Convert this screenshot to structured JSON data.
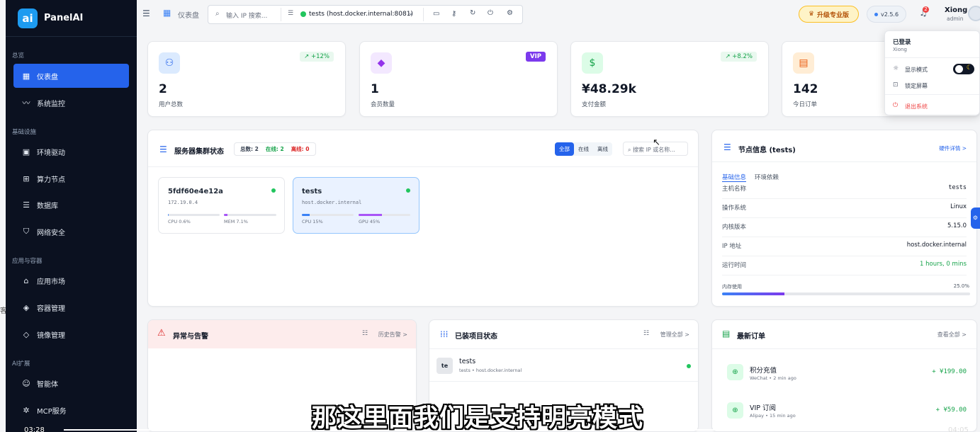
{
  "sidebar": {
    "brand": "PanelAI",
    "logo_letter": "ai",
    "sections": [
      "总览",
      "基础设施",
      "应用与容器",
      "AI扩展"
    ],
    "items": [
      {
        "label": "仪表盘",
        "icon": "dashboard-icon",
        "active": true
      },
      {
        "label": "系统监控",
        "icon": "chart-line-icon"
      },
      {
        "label": "环境驱动",
        "icon": "chip-icon"
      },
      {
        "label": "算力节点",
        "icon": "cpu-icon"
      },
      {
        "label": "数据库",
        "icon": "database-icon"
      },
      {
        "label": "网络安全",
        "icon": "shield-icon"
      },
      {
        "label": "应用市场",
        "icon": "store-icon"
      },
      {
        "label": "容器管理",
        "icon": "box-icon"
      },
      {
        "label": "镜像管理",
        "icon": "layers-icon"
      },
      {
        "label": "智能体",
        "icon": "robot-icon"
      },
      {
        "label": "MCP服务",
        "icon": "network-icon"
      }
    ]
  },
  "topbar": {
    "breadcrumb": "仪表盘",
    "search_placeholder": "输入 IP 搜索...",
    "server": "tests (host.docker.internal:8081)",
    "upgrade": "升级专业版",
    "version": "v2.5.6",
    "notif_count": "2",
    "user": "Xiong",
    "role": "admin"
  },
  "stats": [
    {
      "value": "2",
      "label": "用户总数",
      "trend": "+12%"
    },
    {
      "value": "1",
      "label": "会员数量",
      "badge": "VIP"
    },
    {
      "value": "¥48.29k",
      "label": "支付金额",
      "trend": "+8.2%"
    },
    {
      "value": "142",
      "label": "今日订单"
    }
  ],
  "cluster": {
    "title": "服务器集群状态",
    "total": "总数: 2",
    "online": "在线: 2",
    "offline": "离线: 0",
    "filters": [
      "全部",
      "在线",
      "离线"
    ],
    "search_placeholder": "搜索 IP 或名称...",
    "nodes": [
      {
        "name": "5fdf60e4e12a",
        "ip": "172.19.0.4",
        "m1": "CPU 0.6%",
        "m2": "MEM 7.1%",
        "v1": 0.006,
        "v2": 0.071
      },
      {
        "name": "tests",
        "ip": "host.docker.internal",
        "m1": "CPU 15%",
        "m2": "GPU 45%",
        "v1": 0.15,
        "v2": 0.45
      }
    ]
  },
  "nodeinfo": {
    "title": "节点信息 (tests)",
    "link": "硬件详情 >",
    "tabs": [
      "基础信息",
      "环境依赖"
    ],
    "rows": [
      [
        "主机名称",
        "tests"
      ],
      [
        "操作系统",
        "Linux"
      ],
      [
        "内核版本",
        "5.15.0"
      ],
      [
        "IP 地址",
        "host.docker.internal"
      ],
      [
        "运行时间",
        "1 hours, 0 mins"
      ]
    ],
    "mem_label": "内存使用",
    "mem_value": "25.0%",
    "mem_fraction": 0.25
  },
  "alerts": {
    "title": "异常与告警",
    "link": "历史告警 >"
  },
  "projects": {
    "title": "已装项目状态",
    "link": "管理全部 >",
    "items": [
      {
        "abbr": "te",
        "name": "tests",
        "sub": "tests • host.docker.internal"
      }
    ]
  },
  "orders": {
    "title": "最新订单",
    "link": "查看全部 >",
    "items": [
      {
        "name": "积分充值",
        "sub": "WeChat • 2 min ago",
        "amount": "+ ¥199.00"
      },
      {
        "name": "VIP 订阅",
        "sub": "Alipay • 15 min ago",
        "amount": "+ ¥59.00"
      }
    ]
  },
  "dropdown": {
    "title": "已登录",
    "user": "Xiong",
    "display": "显示模式",
    "lock": "锁定屏幕",
    "logout": "退出系统"
  },
  "video": {
    "subtitle": "那这里面我们是支持明亮模式",
    "time_left": "03:28",
    "time_right": "04:05"
  },
  "colors": {
    "accent": "#2563eb",
    "sidebar": "#0b1120",
    "online": "#22c55e",
    "danger": "#ef4444"
  }
}
